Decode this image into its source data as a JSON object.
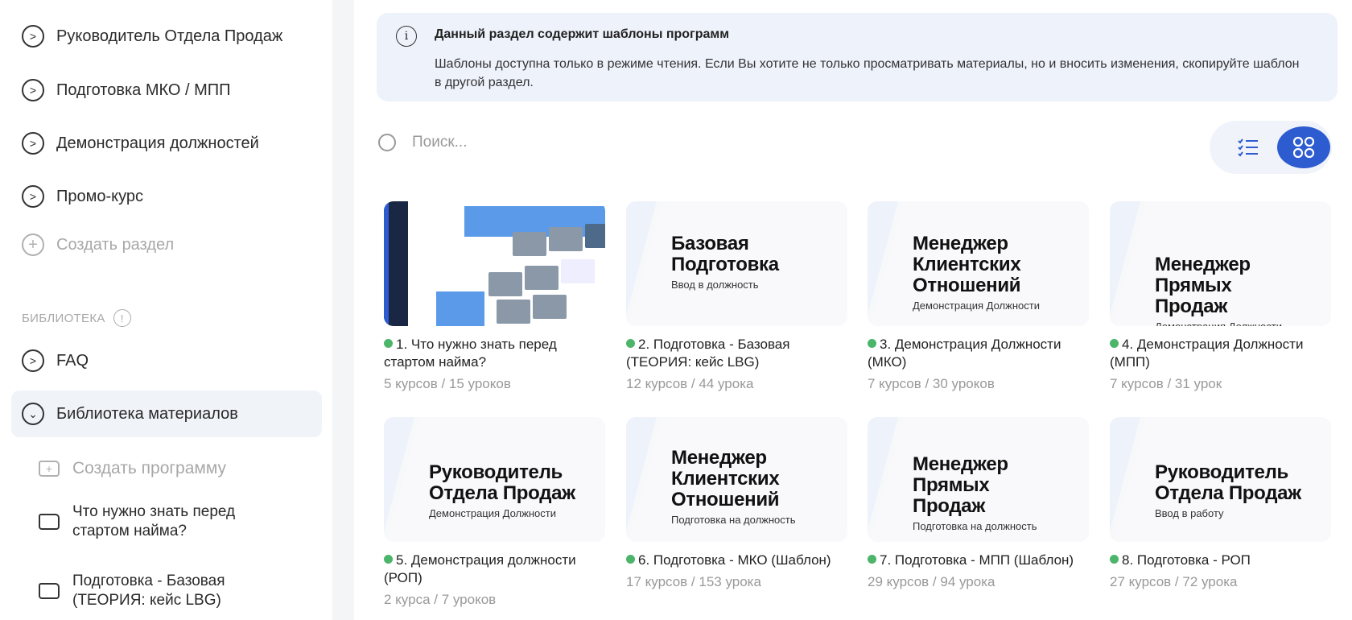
{
  "sidebar": {
    "sections": [
      {
        "label": "Руководитель Отдела Продаж",
        "icon": "chevron-right-circle-icon"
      },
      {
        "label": "Подготовка МКО / МПП",
        "icon": "chevron-right-circle-icon"
      },
      {
        "label": "Демонстрация должностей",
        "icon": "chevron-right-circle-icon"
      },
      {
        "label": "Промо-курс",
        "icon": "chevron-right-circle-icon"
      }
    ],
    "create_section": "Создать раздел",
    "library_heading": "БИБЛИОТЕКА",
    "library_items": [
      {
        "label": "FAQ"
      },
      {
        "label": "Библиотека материалов"
      }
    ],
    "create_program": "Создать программу",
    "programs": [
      {
        "label": "Что нужно знать перед стартом найма?"
      },
      {
        "label": "Подготовка  - Базовая (ТЕОРИЯ: кейс LBG)"
      }
    ]
  },
  "info": {
    "title": "Данный раздел содержит шаблоны программ",
    "body": "Шаблоны доступна только в режиме чтения. Если Вы хотите не только просматривать материалы, но и вносить изменения, скопируйте шаблон в другой раздел."
  },
  "search": {
    "placeholder": "Поиск..."
  },
  "view": {
    "active": "grid"
  },
  "colors": {
    "accent": "#2d5bd0",
    "status": "#4cb56a",
    "info_bg": "#eef2fb"
  },
  "cards": [
    {
      "cover_title": "",
      "cover_sub": "",
      "title": "1. Что нужно знать перед стартом найма?",
      "meta": "5 курсов / 15 уроков"
    },
    {
      "cover_title": "Базовая Подготовка",
      "cover_sub": "Ввод в должность",
      "title": "2. Подготовка  - Базовая (ТЕОРИЯ: кейс LBG)",
      "meta": "12 курсов / 44 урока"
    },
    {
      "cover_title": "Менеджер Клиентских Отношений",
      "cover_sub": "Демонстрация Должности",
      "title": "3. Демонстрация Должности (МКО)",
      "meta": "7 курсов / 30 уроков"
    },
    {
      "cover_title": "Менеджер Прямых Продаж",
      "cover_sub": "Демонстрация Должности",
      "title": "4. Демонстрация Должности (МПП)",
      "meta": "7 курсов / 31 урок"
    },
    {
      "cover_title": "Руководитель Отдела Продаж",
      "cover_sub": "Демонстрация Должности",
      "title": "5. Демонстрация должности (РОП)",
      "meta": "2 курса / 7 уроков"
    },
    {
      "cover_title": "Менеджер Клиентских Отношений",
      "cover_sub": "Подготовка на должность",
      "title": "6. Подготовка - МКО (Шаблон)",
      "meta": "17 курсов / 153 урока"
    },
    {
      "cover_title": "Менеджер Прямых Продаж",
      "cover_sub": "Подготовка на должность",
      "title": "7. Подготовка - МПП (Шаблон)",
      "meta": "29 курсов / 94 урока"
    },
    {
      "cover_title": "Руководитель Отдела Продаж",
      "cover_sub": "Ввод в работу",
      "title": "8. Подготовка - РОП",
      "meta": "27 курсов / 72 урока"
    }
  ]
}
